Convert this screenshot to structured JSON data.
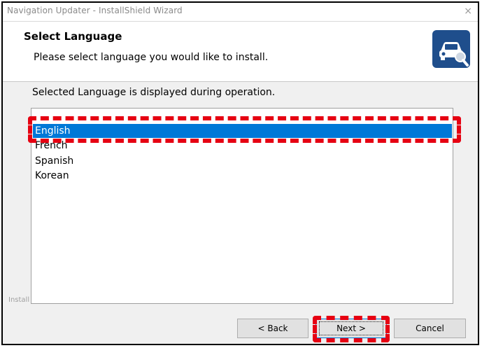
{
  "window": {
    "title": "Navigation Updater - InstallShield Wizard",
    "close_glyph": "×"
  },
  "header": {
    "title": "Select Language",
    "subtitle": "Please select language you would like to install."
  },
  "content": {
    "description": "Selected Language is displayed during operation.",
    "languages": [
      "English",
      "French",
      "Spanish",
      "Korean"
    ],
    "selected_language": "English"
  },
  "footer": {
    "brand_label": "Install"
  },
  "buttons": {
    "back": "< Back",
    "next": "Next >",
    "cancel": "Cancel"
  },
  "colors": {
    "selection": "#0078d7",
    "highlight": "#e60012",
    "icon_bg": "#1f4e8c"
  }
}
